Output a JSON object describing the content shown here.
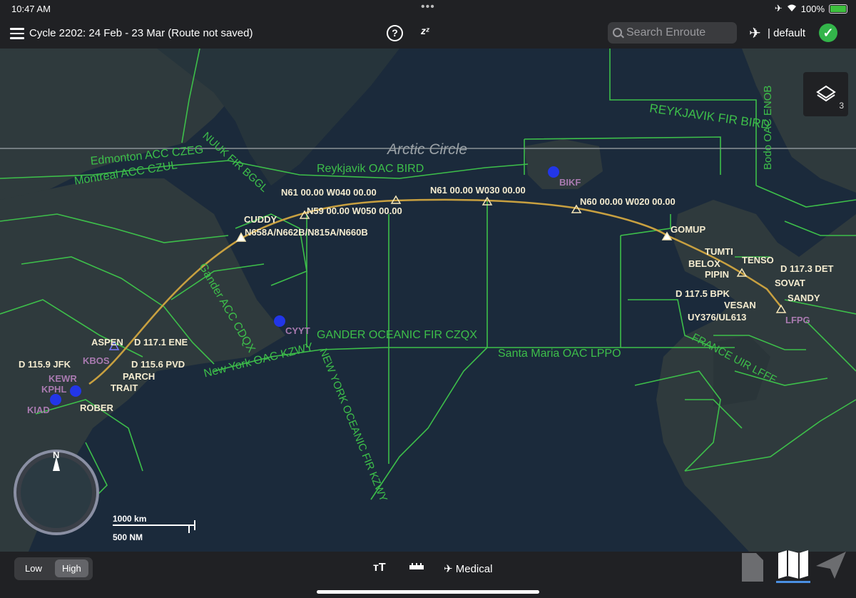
{
  "status_bar": {
    "time": "10:47 AM",
    "battery": "100%",
    "dots": "•••"
  },
  "toolbar": {
    "menu_icon": "hamburger-icon",
    "cycle_text": "Cycle 2202: 24 Feb - 23 Mar (Route not saved)",
    "help_icon": "?",
    "sleep_icon": "zᶻ",
    "search_placeholder": "Search Enroute",
    "profile_label": "| default",
    "check_icon": "✓"
  },
  "layers": {
    "count": "3"
  },
  "map": {
    "region_labels": [
      "Arctic Circle",
      "REYKJAVIK FIR BIRD",
      "Bodo OAC ENOB",
      "NUUK FIR BGGL",
      "Edmonton ACC CZEG",
      "Montreal ACC CZUL",
      "Reykjavik OAC BIRD",
      "Gander ACC CDQX",
      "GANDER OCEANIC FIR CZQX",
      "NEW YORK OCEANIC FIR KZWY",
      "New York OAC KZWY",
      "Santa Maria OAC LPPO",
      "FRANCE UIR LFFF"
    ],
    "waypoints": [
      "CUDDY",
      "N658A/N662B/N815A/N660B",
      "N61 00.00 W040 00.00",
      "N59 00.00 W050 00.00",
      "N61 00.00 W030 00.00",
      "N60 00.00 W020 00.00",
      "GOMUP",
      "TUMTI",
      "TENSO",
      "BELOX",
      "PIPIN",
      "D 117.3 DET",
      "SOVAT",
      "D 117.5 BPK",
      "SANDY",
      "VESAN",
      "UY376/UL613",
      "ASPEN",
      "D 117.1 ENE",
      "D 115.9 JFK",
      "D 115.6 PVD",
      "PARCH",
      "TRAIT",
      "ROBER"
    ],
    "airports": [
      "BIKF",
      "CYYT",
      "KBOS",
      "KEWR",
      "KPHL",
      "KIAD",
      "LFPG"
    ],
    "compass_label": "N",
    "scale_km": "1000 km",
    "scale_nm": "500 NM"
  },
  "bottom_bar": {
    "low_label": "Low",
    "high_label": "High",
    "text_size_icon": "тT",
    "ruler_icon": "▬",
    "medical_label": "Medical"
  },
  "colors": {
    "route": "#c8a040",
    "boundary": "#3dbf4a",
    "water": "#1b2a3b",
    "land": "#2f3a3d",
    "airport": "#2236e8"
  }
}
